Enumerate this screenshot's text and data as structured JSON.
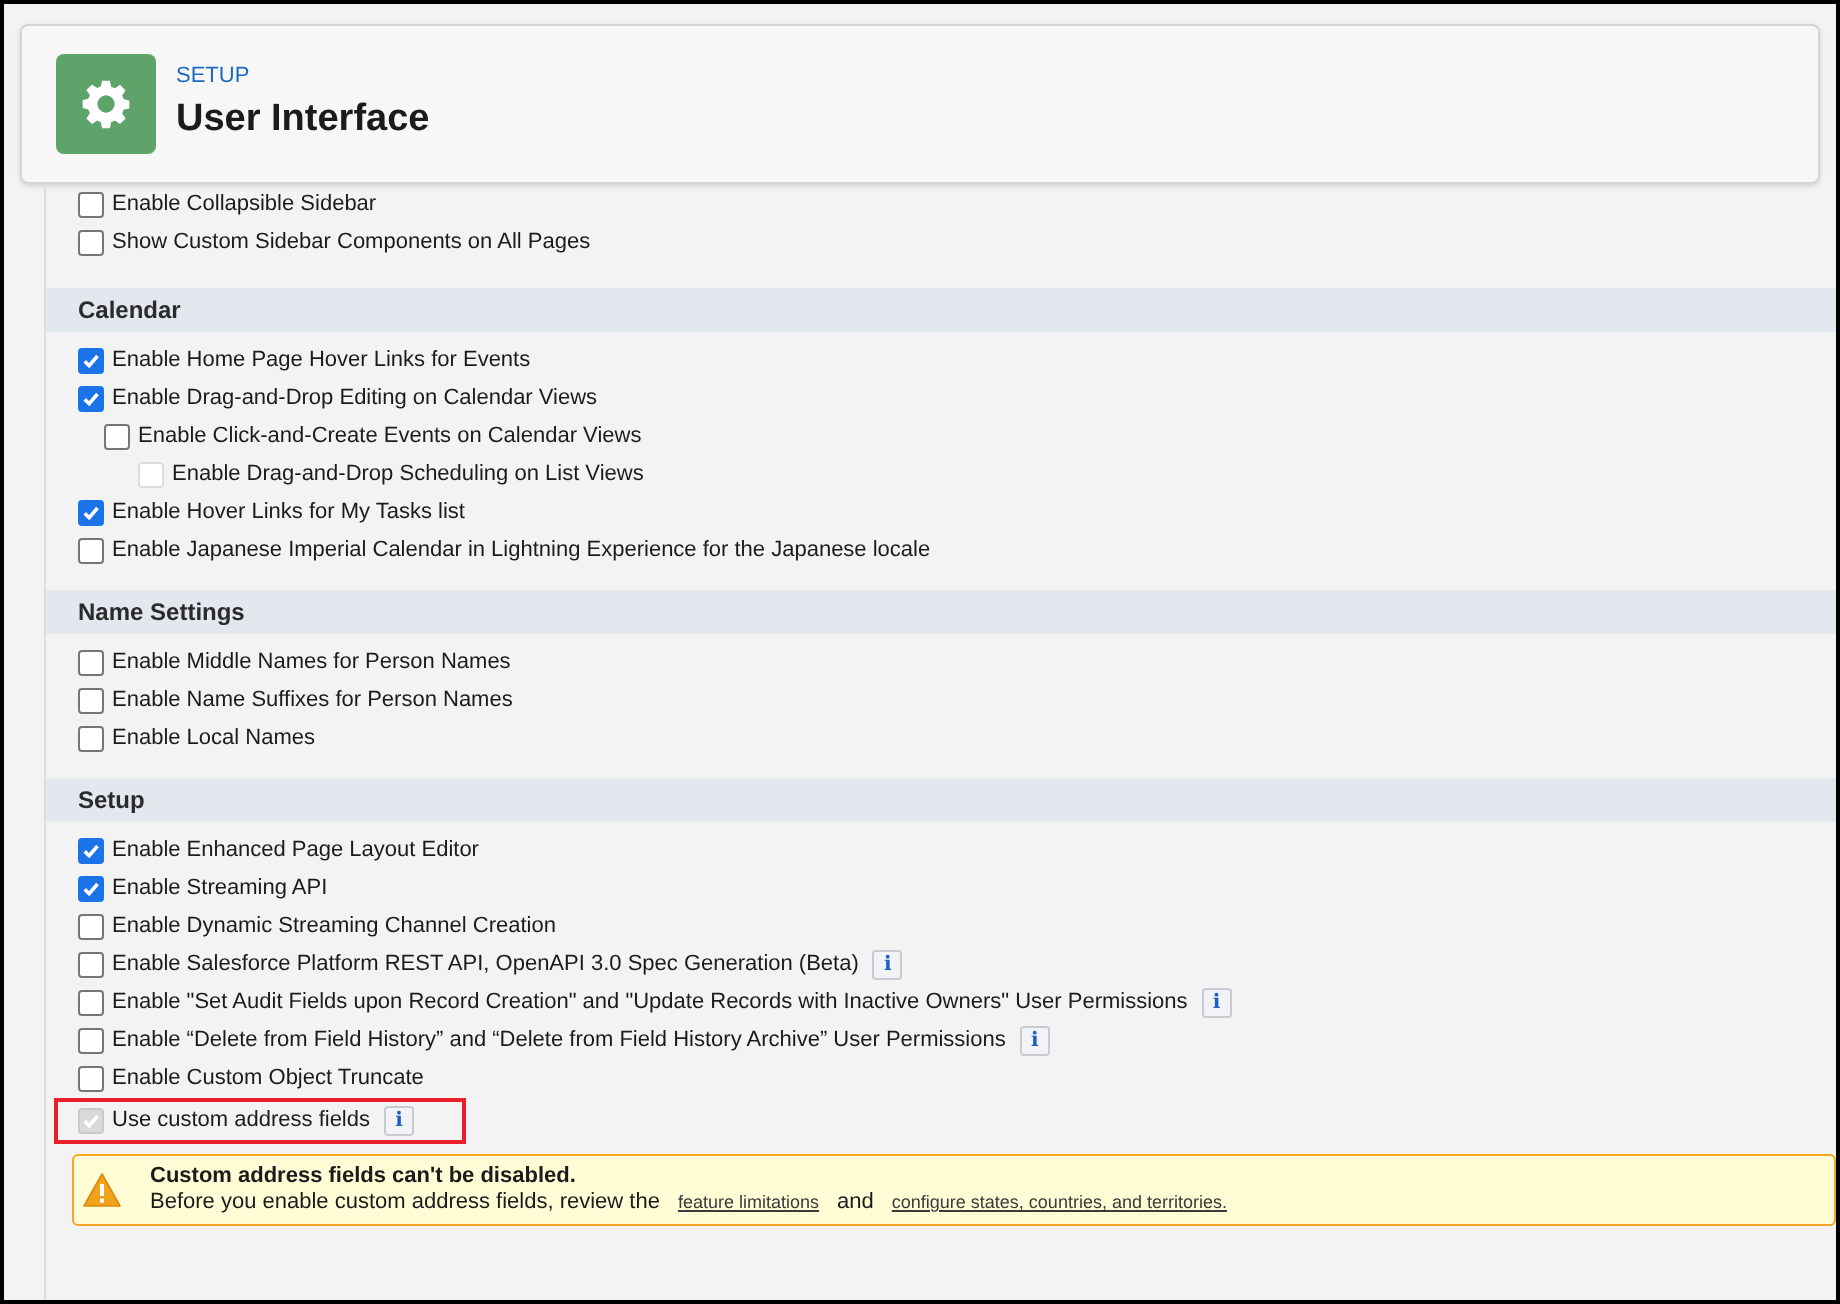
{
  "header": {
    "breadcrumb": "SETUP",
    "title": "User Interface"
  },
  "top_items": [
    {
      "label": "Enable Collapsible Sidebar",
      "checked": false,
      "disabled": false
    },
    {
      "label": "Show Custom Sidebar Components on All Pages",
      "checked": false,
      "disabled": false
    }
  ],
  "sections": [
    {
      "title": "Calendar",
      "items": [
        {
          "label": "Enable Home Page Hover Links for Events",
          "checked": true,
          "disabled": false
        },
        {
          "label": "Enable Drag-and-Drop Editing on Calendar Views",
          "checked": true,
          "disabled": false,
          "children": [
            {
              "label": "Enable Click-and-Create Events on Calendar Views",
              "checked": false,
              "disabled": false,
              "children": [
                {
                  "label": "Enable Drag-and-Drop Scheduling on List Views",
                  "checked": false,
                  "disabled": true
                }
              ]
            }
          ]
        },
        {
          "label": "Enable Hover Links for My Tasks list",
          "checked": true,
          "disabled": false
        },
        {
          "label": "Enable Japanese Imperial Calendar in Lightning Experience for the Japanese locale",
          "checked": false,
          "disabled": false
        }
      ]
    },
    {
      "title": "Name Settings",
      "items": [
        {
          "label": "Enable Middle Names for Person Names",
          "checked": false,
          "disabled": false
        },
        {
          "label": "Enable Name Suffixes for Person Names",
          "checked": false,
          "disabled": false
        },
        {
          "label": "Enable Local Names",
          "checked": false,
          "disabled": false
        }
      ]
    },
    {
      "title": "Setup",
      "items": [
        {
          "label": "Enable Enhanced Page Layout Editor",
          "checked": true,
          "disabled": false
        },
        {
          "label": "Enable Streaming API",
          "checked": true,
          "disabled": false
        },
        {
          "label": "Enable Dynamic Streaming Channel Creation",
          "checked": false,
          "disabled": false
        },
        {
          "label": "Enable Salesforce Platform REST API, OpenAPI 3.0 Spec Generation (Beta)",
          "checked": false,
          "disabled": false,
          "info": "i"
        },
        {
          "label": "Enable \"Set Audit Fields upon Record Creation\" and \"Update Records with Inactive Owners\" User Permissions",
          "checked": false,
          "disabled": false,
          "info": "i"
        },
        {
          "label": "Enable “Delete from Field History” and “Delete from Field History Archive” User Permissions",
          "checked": false,
          "disabled": false,
          "info": "i"
        },
        {
          "label": "Enable Custom Object Truncate",
          "checked": false,
          "disabled": false
        },
        {
          "label": "Use custom address fields",
          "checked": true,
          "disabled": true,
          "info": "i",
          "highlighted": true
        }
      ]
    }
  ],
  "warning": {
    "title": "Custom address fields can't be disabled.",
    "text": "Before you enable custom address fields, review the",
    "link_1": "feature limitations",
    "joiner": "and",
    "link_2": "configure states, countries, and territories."
  }
}
